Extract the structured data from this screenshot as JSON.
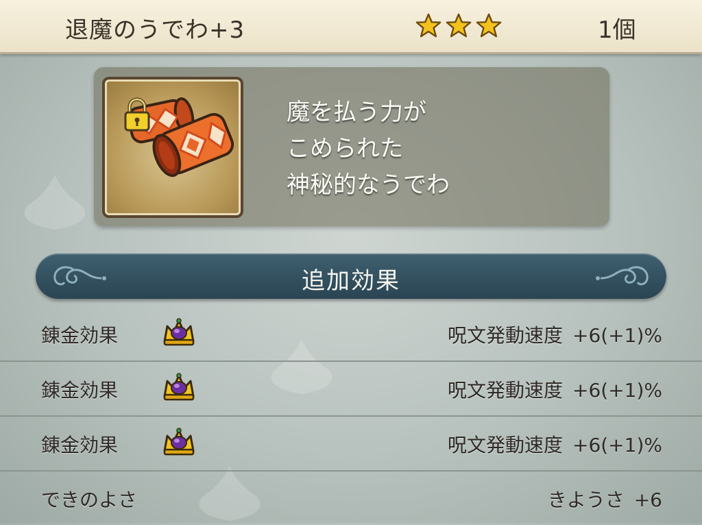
{
  "header": {
    "item_name": "退魔のうでわ+3",
    "rarity_stars": 3,
    "count": "1個"
  },
  "item": {
    "icon": "orange-bracelet-icon",
    "locked": true,
    "description": [
      "魔を払う力が",
      "こめられた",
      "神秘的なうでわ"
    ]
  },
  "section": {
    "title": "追加効果"
  },
  "effects": [
    {
      "label": "錬金効果",
      "icon": "alchemy-crown-icon",
      "stat": "呪文発動速度",
      "value": "+6(+1)%"
    },
    {
      "label": "錬金効果",
      "icon": "alchemy-crown-icon",
      "stat": "呪文発動速度",
      "value": "+6(+1)%"
    },
    {
      "label": "錬金効果",
      "icon": "alchemy-crown-icon",
      "stat": "呪文発動速度",
      "value": "+6(+1)%"
    }
  ],
  "quality": {
    "label": "できのよさ",
    "stat": "きようさ",
    "value": "+6"
  },
  "colors": {
    "star": "#f3c21c",
    "banner": "#34505e",
    "header_bg": "#f3ecd6"
  }
}
